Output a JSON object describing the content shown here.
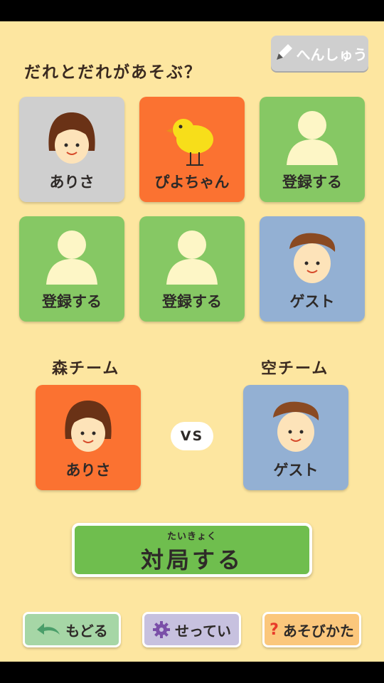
{
  "header": {
    "title": "だれとだれがあそぶ？",
    "edit_label": "へんしゅう"
  },
  "players": [
    {
      "name": "ありさ",
      "icon": "girl-face-icon",
      "color": "#cfcfcf"
    },
    {
      "name": "ぴよちゃん",
      "icon": "chick-icon",
      "color": "#fb7231"
    },
    {
      "name": "登録する",
      "icon": "silhouette-icon",
      "color": "#86c864"
    },
    {
      "name": "登録する",
      "icon": "silhouette-icon",
      "color": "#86c864"
    },
    {
      "name": "登録する",
      "icon": "silhouette-icon",
      "color": "#86c864"
    },
    {
      "name": "ゲスト",
      "icon": "boy-face-icon",
      "color": "#93b0d3"
    }
  ],
  "teams": {
    "left": {
      "label": "森チーム",
      "player": "ありさ",
      "color": "#fb7231"
    },
    "right": {
      "label": "空チーム",
      "player": "ゲスト",
      "color": "#93b0d3"
    },
    "vs": "VS"
  },
  "start": {
    "ruby": "たいきょく",
    "label": "対局する"
  },
  "footer": {
    "back": "もどる",
    "settings": "せってい",
    "howto": "あそびかた"
  }
}
